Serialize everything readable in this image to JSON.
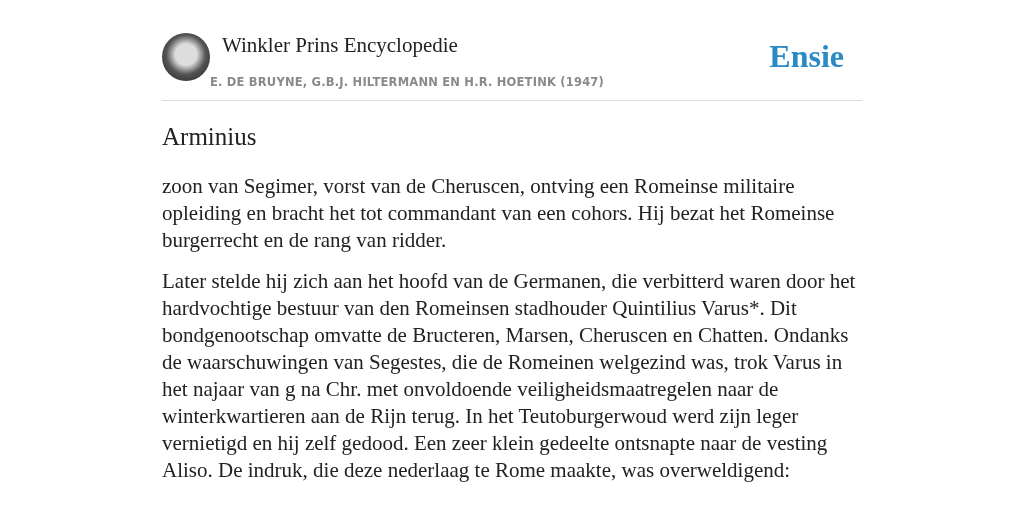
{
  "header": {
    "source_title": "Winkler Prins Encyclopedie",
    "authors": "E. DE BRUYNE, G.B.J. HILTERMANN EN H.R. HOETINK (1947)",
    "logo": "Ensie"
  },
  "article": {
    "title": "Arminius",
    "paragraphs": [
      "zoon van Segimer, vorst van de Cheruscen, ontving een Romeinse militaire opleiding en bracht het tot commandant van een cohors. Hij bezat het Romeinse burgerrecht en de rang van ridder.",
      "Later stelde hij zich aan het hoofd van de Germanen, die verbitterd waren door het hardvochtige bestuur van den Romeinsen stadhouder Quintilius Varus*. Dit bondgenootschap omvatte de Bructeren, Marsen, Cheruscen en Chatten. Ondanks de waarschuwingen van Segestes, die de Romeinen welgezind was, trok Varus in het najaar van g na Chr. met onvoldoende veiligheidsmaatregelen naar de winterkwartieren aan de Rijn terug. In het Teutoburgerwoud werd zijn leger vernietigd en hij zelf gedood. Een zeer klein gedeelte ontsnapte naar de vesting Aliso. De indruk, die deze nederlaag te Rome maakte, was overweldigend:"
    ]
  }
}
